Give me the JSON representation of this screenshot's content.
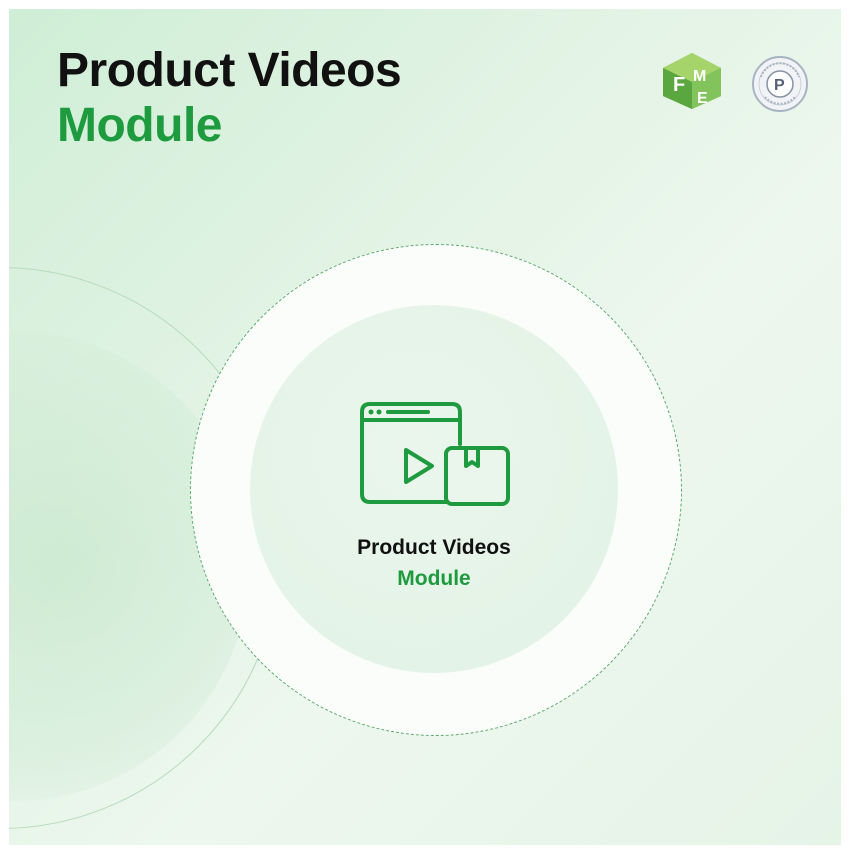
{
  "header": {
    "title_line1": "Product Videos",
    "title_line2": "Module"
  },
  "badge": {
    "title_line1": "Product Videos",
    "title_line2": "Module",
    "icon": "video-product-icon"
  },
  "logos": {
    "fme": {
      "icon": "fme-cube-logo",
      "text": "FME"
    },
    "partner": {
      "icon": "prestashop-partner-logo",
      "text": "PRESTASHOP PARTNER AGENCY"
    }
  },
  "colors": {
    "accent": "#1e9a3f",
    "text": "#111111",
    "background": "#e2f3e4"
  }
}
